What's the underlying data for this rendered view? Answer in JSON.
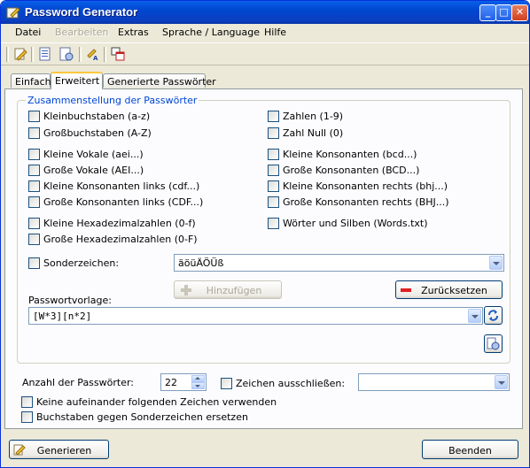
{
  "window": {
    "title": "Password Generator",
    "minimize_label": "_",
    "maximize_label": "□",
    "close_label": "✕"
  },
  "menu": {
    "file": "Datei",
    "edit": "Bearbeiten",
    "extras": "Extras",
    "language": "Sprache / Language",
    "help": "Hilfe"
  },
  "toolbar": {
    "icons": [
      "edit-icon",
      "document-list-icon",
      "document-settings-icon",
      "font-icon",
      "windows-icon"
    ]
  },
  "tabs": {
    "simple": "Einfach",
    "advanced": "Erweitert",
    "generated": "Generierte Passwörter"
  },
  "composition": {
    "title": "Zusammenstellung der Passwörter",
    "left": [
      {
        "label": "Kleinbuchstaben (a-z)",
        "checked": false
      },
      {
        "label": "Großbuchstaben (A-Z)",
        "checked": false
      },
      {
        "label": "Kleine Vokale (aei...)",
        "checked": false
      },
      {
        "label": "Große Vokale (AEI...)",
        "checked": false
      },
      {
        "label": "Kleine Konsonanten links (cdf...)",
        "checked": false
      },
      {
        "label": "Große Konsonanten links (CDF...)",
        "checked": false
      },
      {
        "label": "Kleine Hexadezimalzahlen (0-f)",
        "checked": false
      },
      {
        "label": "Große Hexadezimalzahlen (0-F)",
        "checked": false
      }
    ],
    "right": [
      {
        "label": "Zahlen (1-9)",
        "checked": false
      },
      {
        "label": "Zahl Null (0)",
        "checked": false
      },
      {
        "label": "Kleine Konsonanten (bcd...)",
        "checked": false
      },
      {
        "label": "Große Konsonanten (BCD...)",
        "checked": false
      },
      {
        "label": "Kleine Konsonanten rechts (bhj...)",
        "checked": false
      },
      {
        "label": "Große Konsonanten rechts (BHJ...)",
        "checked": false
      },
      {
        "label": "Wörter und Silben (Words.txt)",
        "checked": false
      }
    ],
    "special_label": "Sonderzeichen:",
    "special_value": "äöüÄÖÜß",
    "add_button": "Hinzufügen",
    "reset_button": "Zurücksetzen",
    "template_label": "Passwortvorlage:",
    "template_value": "[W*3][n*2]"
  },
  "options": {
    "count_label": "Anzahl der Passwörter:",
    "count_value": "22",
    "exclude_label": "Zeichen ausschließen:",
    "exclude_value": "",
    "no_consecutive": "Keine aufeinander folgenden Zeichen verwenden",
    "replace_letters": "Buchstaben gegen Sonderzeichen ersetzen"
  },
  "footer": {
    "generate": "Generieren",
    "quit": "Beenden"
  },
  "colors": {
    "title_blue": "#0047D0",
    "group_title": "#0046D5",
    "tab_highlight": "#FFC83C"
  }
}
